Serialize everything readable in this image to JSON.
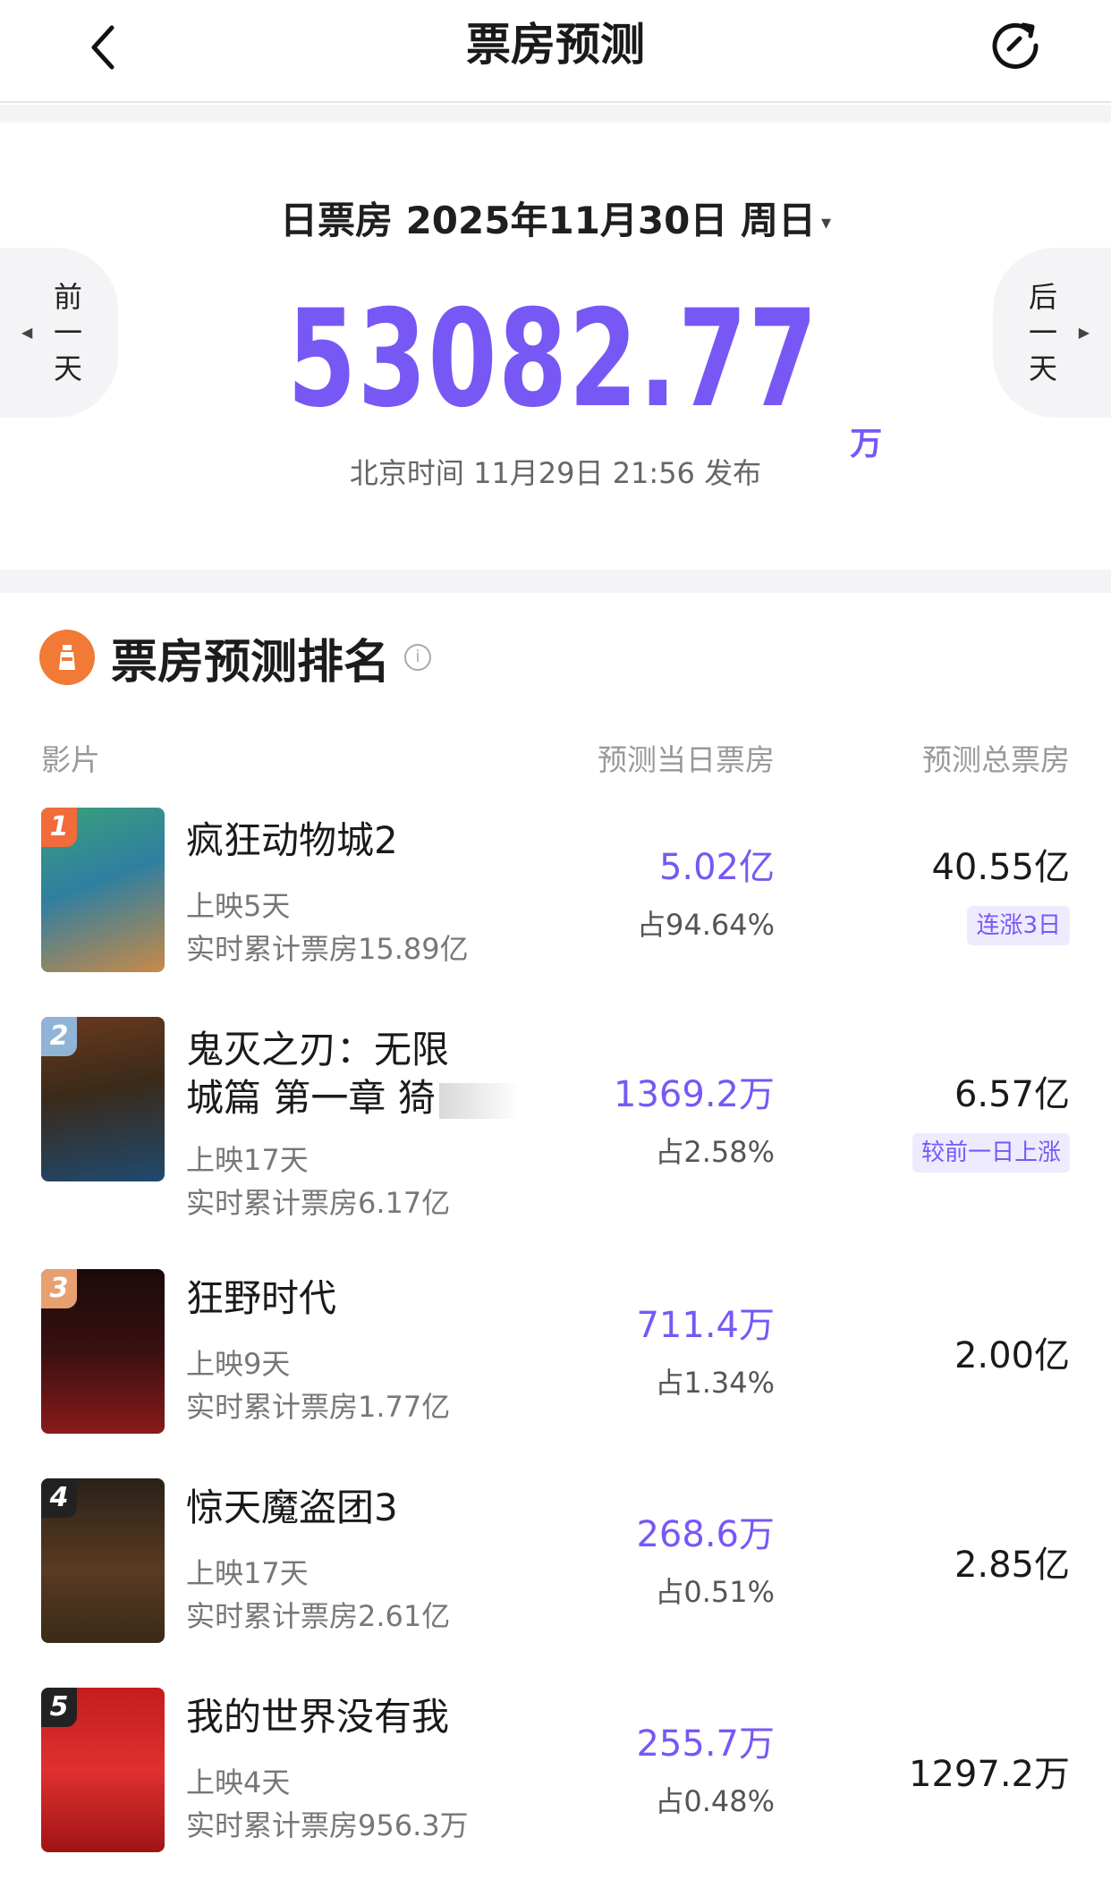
{
  "nav": {
    "title": "票房预测"
  },
  "forecast": {
    "date_label": "日票房 2025年11月30日 周日",
    "caret": "▾",
    "value": "53082.77",
    "unit": "万",
    "publish": "北京时间 11月29日 21:56 发布",
    "prev_day": [
      "前",
      "一",
      "天"
    ],
    "next_day": [
      "后",
      "一",
      "天"
    ]
  },
  "ranking": {
    "title": "票房预测排名",
    "info": "i",
    "columns": {
      "film": "影片",
      "day": "预测当日票房",
      "total": "预测总票房"
    },
    "rows": [
      {
        "rank": "1",
        "name_lines": [
          "疯狂动物城2"
        ],
        "days": "上映5天",
        "cumulative": "实时累计票房15.89亿",
        "day_value": "5.02亿",
        "share": "占94.64%",
        "total": "40.55亿",
        "tag": "连涨3日",
        "badge_color": "#f26b3a",
        "poster_colors": [
          "#2f8a6a",
          "#d8a060"
        ]
      },
      {
        "rank": "2",
        "name_lines": [
          "鬼灭之刃：无限",
          "城篇 第一章 猗"
        ],
        "days": "上映17天",
        "cumulative": "实时累计票房6.17亿",
        "day_value": "1369.2万",
        "share": "占2.58%",
        "total": "6.57亿",
        "tag": "较前一日上涨",
        "badge_color": "#8fb4d6",
        "poster_colors": [
          "#5a3a22",
          "#2a4c6e"
        ]
      },
      {
        "rank": "3",
        "name_lines": [
          "狂野时代"
        ],
        "days": "上映9天",
        "cumulative": "实时累计票房1.77亿",
        "day_value": "711.4万",
        "share": "占1.34%",
        "total": "2.00亿",
        "tag": "",
        "badge_color": "#e8a070",
        "poster_colors": [
          "#1a0a0a",
          "#8a1a1a"
        ]
      },
      {
        "rank": "4",
        "name_lines": [
          "惊天魔盗团3"
        ],
        "days": "上映17天",
        "cumulative": "实时累计票房2.61亿",
        "day_value": "268.6万",
        "share": "占0.51%",
        "total": "2.85亿",
        "tag": "",
        "badge_color": "#222222",
        "poster_colors": [
          "#2a2118",
          "#6a4a2a"
        ]
      },
      {
        "rank": "5",
        "name_lines": [
          "我的世界没有我"
        ],
        "days": "上映4天",
        "cumulative": "实时累计票房956.3万",
        "day_value": "255.7万",
        "share": "占0.48%",
        "total": "1297.2万",
        "tag": "",
        "badge_color": "#222222",
        "poster_colors": [
          "#b01818",
          "#e02a2a"
        ]
      }
    ]
  },
  "colors": {
    "accent": "#7758f5",
    "tag_bg": "#efebff",
    "logo": "#f07a36"
  }
}
